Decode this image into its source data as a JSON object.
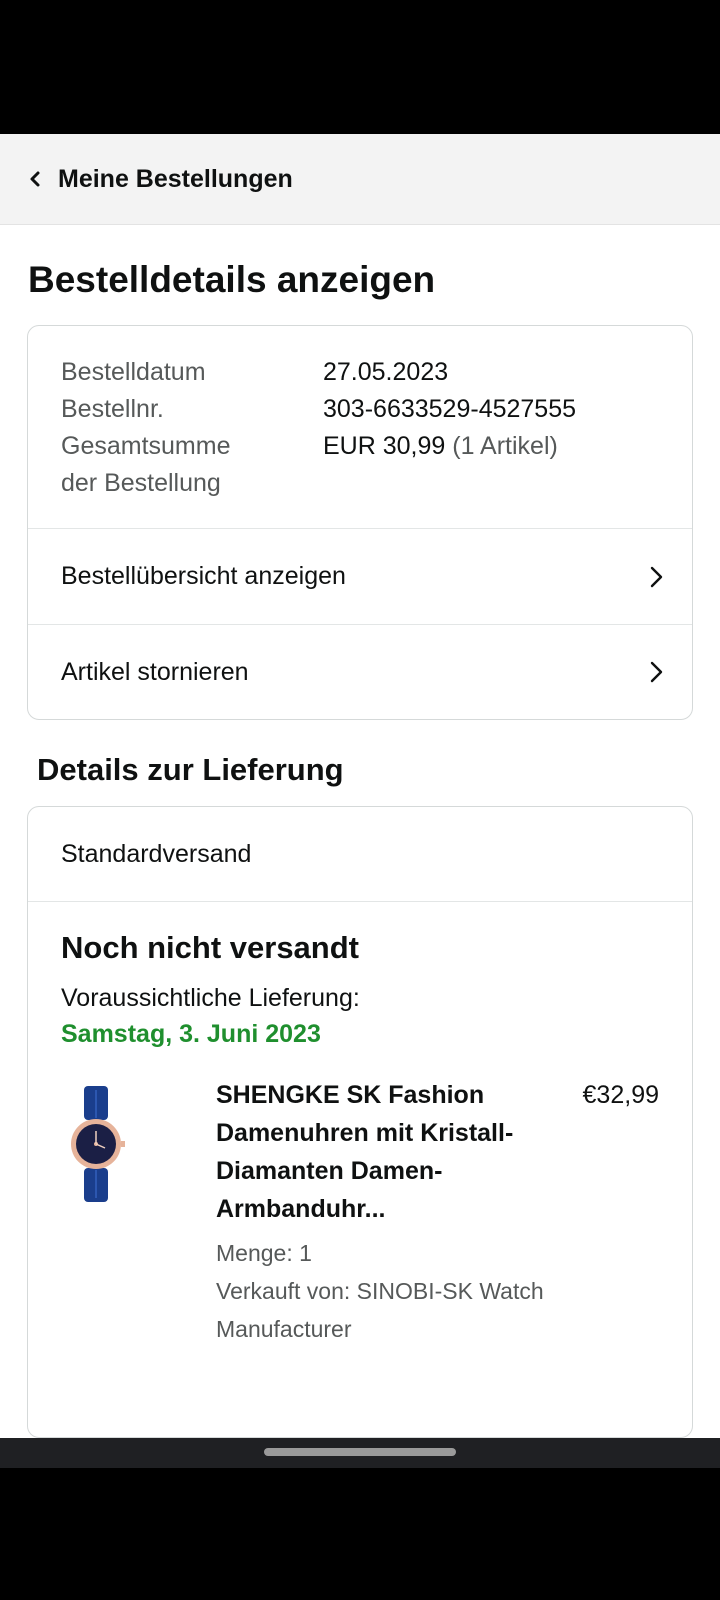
{
  "header": {
    "back_label": "Meine Bestellungen"
  },
  "page_title": "Bestelldetails anzeigen",
  "order_summary": {
    "rows": [
      {
        "key": "Bestelldatum",
        "value": "27.05.2023"
      },
      {
        "key": "Bestellnr.",
        "value": "303-6633529-4527555"
      }
    ],
    "total_key_line1": "Gesamtsumme",
    "total_key_line2": "der Bestellung",
    "total_value": "EUR 30,99",
    "total_count": "(1 Artikel)"
  },
  "actions": [
    {
      "label": "Bestellübersicht anzeigen"
    },
    {
      "label": "Artikel stornieren"
    }
  ],
  "delivery": {
    "section_title": "Details zur Lieferung",
    "shipping_method": "Standardversand",
    "status": "Noch nicht versandt",
    "expected_label": "Voraussichtliche Lieferung:",
    "expected_date": "Samstag, 3. Juni 2023",
    "item": {
      "title": "SHENGKE SK Fashion Damenuhren mit Kristall-Diamanten Damen-Armbanduhr...",
      "price": "€32,99",
      "quantity": "Menge: 1",
      "seller": "Verkauft von: SINOBI-SK Watch Manufacturer"
    }
  },
  "colors": {
    "delivery_date": "#1f8f2e",
    "header_bg": "#f3f3f3",
    "muted_text": "#565959"
  }
}
